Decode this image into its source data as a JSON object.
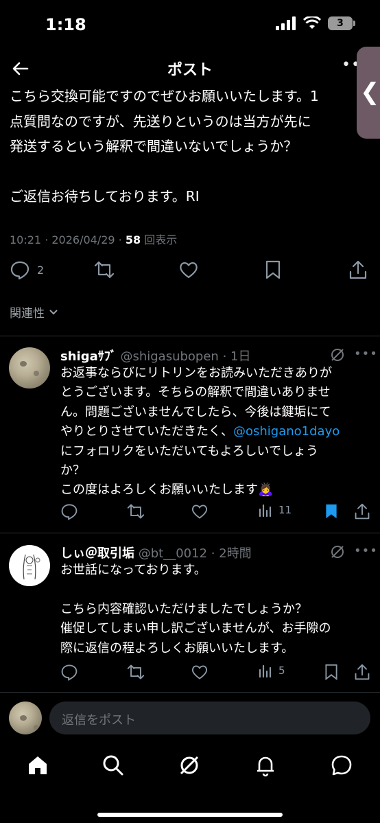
{
  "status_bar": {
    "time": "1:18",
    "battery": "3"
  },
  "header": {
    "title": "ポスト"
  },
  "post": {
    "lines": [
      "こちら交換可能ですのでぜひお願いいたします。1",
      "点質問なのですが、先送りというのは当方が先に",
      "発送するという解釈で間違いないでしょうか？",
      "",
      "ご返信お待ちしております。RI"
    ],
    "timestamp": "10:21 · 2026/04/29 · ",
    "views_count": "58",
    "views_label": "回表示",
    "reply_count": "2"
  },
  "relevance": {
    "label": "関連性"
  },
  "replies": [
    {
      "name": "shigaｻﾌﾞ",
      "handle": "@shigasubopen · 1日",
      "lines": [
        "お返事ならびにリトリンをお読みいただきありが",
        "とうございます。そちらの解釈で間違いありませ",
        "ん。問題ございませんでしたら、今後は鍵垢にて",
        "やりとりさせていただきたく、"
      ],
      "mention": "@oshigano1dayo",
      "lines_after": [
        "にフォロリクをいただいてもよろしいでしょう",
        "か？",
        "この度はよろしくお願いいたします🙇‍♀️"
      ],
      "views": "11"
    },
    {
      "name": "しぃ＠取引垢",
      "handle": "@bt__0012 · 2時間",
      "lines": [
        "お世話になっております。",
        "",
        "こちら内容確認いただけましたでしょうか？",
        "催促してしまい申し訳ございませんが、お手隙の",
        "際に返信の程よろしくお願いいたします。"
      ],
      "views": "5"
    }
  ],
  "compose": {
    "placeholder": "返信をポスト"
  },
  "colors": {
    "accent": "#1d9bf0",
    "background": "#000000",
    "muted": "#71767b"
  }
}
